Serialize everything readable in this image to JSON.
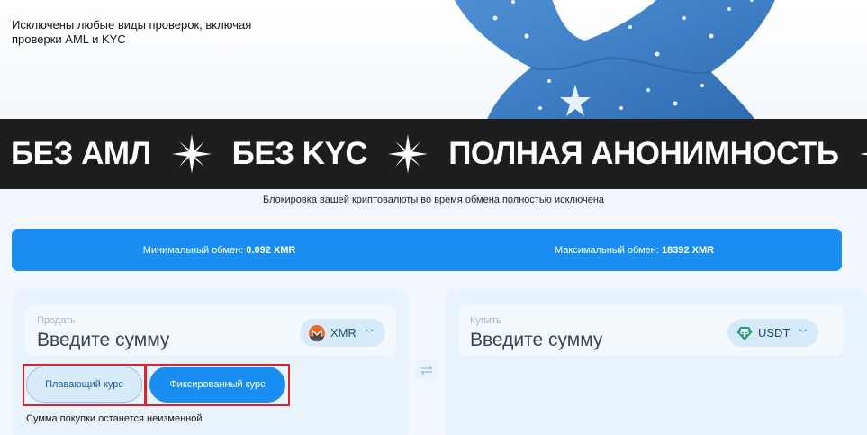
{
  "hero": {
    "text": "Исключены любые виды проверок, включая проверки AML и KYC"
  },
  "banner": {
    "items": [
      "БЕЗ АМЛ",
      "БЕЗ KYC",
      "ПОЛНАЯ АНОНИМНОСТЬ"
    ]
  },
  "notice": "Блокировка вашей криптовалюты во время обмена полностью исключена",
  "limits": {
    "min_label": "Минимальный обмен:",
    "min_value": "0.092 XMR",
    "max_label": "Максимальный обмен:",
    "max_value": "18392 XMR"
  },
  "sell": {
    "label": "Продать",
    "placeholder": "Введите сумму",
    "currency": "XMR",
    "currency_icon": "monero-icon"
  },
  "buy": {
    "label": "Купить",
    "placeholder": "Введите сумму",
    "currency": "USDT",
    "currency_icon": "tether-icon"
  },
  "rate": {
    "floating_label": "Плавающий курс",
    "fixed_label": "Фиксированный курс",
    "selected": "fixed",
    "hint": "Сумма покупки останется неизменной"
  },
  "colors": {
    "accent": "#1a8ef0",
    "banner_bg": "#1d1d1d",
    "highlight_border": "#e0222a"
  }
}
